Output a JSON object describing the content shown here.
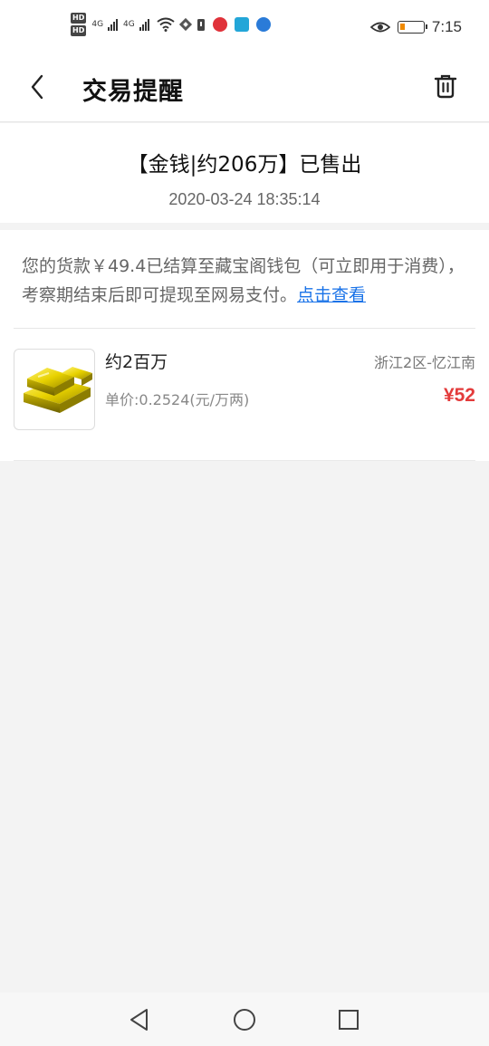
{
  "status_bar": {
    "hd_top": "HD",
    "hd_bottom": "HD",
    "sig1": "4G",
    "sig2": "4G",
    "time": "7:15"
  },
  "header": {
    "title": "交易提醒"
  },
  "notice": {
    "title": "【金钱|约206万】已售出",
    "timestamp": "2020-03-24 18:35:14"
  },
  "detail": {
    "message": "您的货款￥49.4已结算至藏宝阁钱包（可立即用于消费），考察期结束后即可提现至网易支付。",
    "link_label": "点击查看"
  },
  "item": {
    "name": "约2百万",
    "server": "浙江2区-忆江南",
    "unit_price": "单价:0.2524(元/万两)",
    "price": "¥52"
  },
  "colors": {
    "accent_link": "#1a73e8",
    "price_red": "#e33b3b",
    "battery": "#f08a00"
  },
  "icons": [
    "back-arrow-icon",
    "trash-icon",
    "gold-bars-icon",
    "nav-back-icon",
    "nav-home-icon",
    "nav-recents-icon"
  ]
}
